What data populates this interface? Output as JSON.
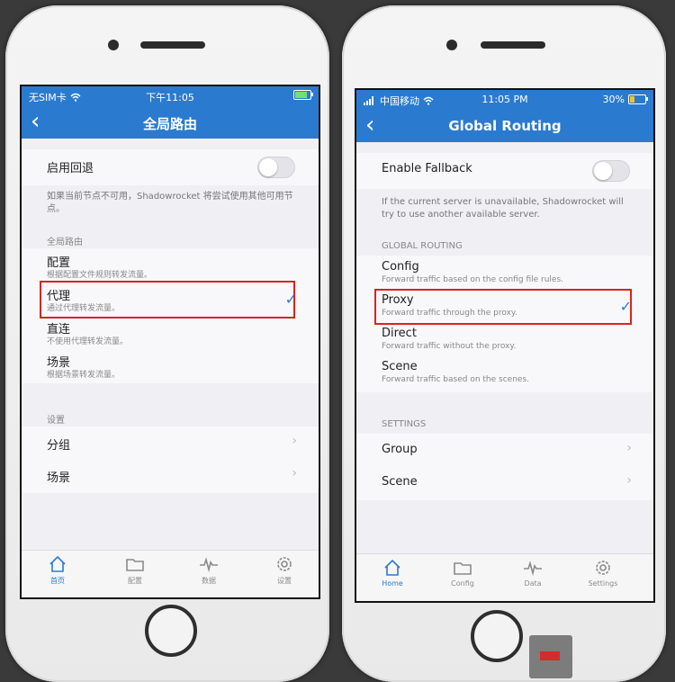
{
  "left": {
    "status": {
      "carrier": "无SIM卡",
      "time": "下午11:05"
    },
    "nav": {
      "back": "‹",
      "title": "全局路由"
    },
    "fallback": {
      "label": "启用回退",
      "enabled": false,
      "note": "如果当前节点不可用，Shadowrocket 将尝试使用其他可用节点。"
    },
    "routing_header": "全局路由",
    "routes": [
      {
        "title": "配置",
        "subtitle": "根据配置文件规则转发流量。",
        "selected": false
      },
      {
        "title": "代理",
        "subtitle": "通过代理转发流量。",
        "selected": true
      },
      {
        "title": "直连",
        "subtitle": "不使用代理转发流量。",
        "selected": false
      },
      {
        "title": "场景",
        "subtitle": "根据场景转发流量。",
        "selected": false
      }
    ],
    "settings_header": "设置",
    "settings": [
      {
        "label": "分组"
      },
      {
        "label": "场景"
      }
    ],
    "tabs": [
      {
        "label": "首页",
        "icon": "home-icon",
        "active": true
      },
      {
        "label": "配置",
        "icon": "folder-icon",
        "active": false
      },
      {
        "label": "数据",
        "icon": "pulse-icon",
        "active": false
      },
      {
        "label": "设置",
        "icon": "gear-icon",
        "active": false
      }
    ]
  },
  "right": {
    "status": {
      "carrier": "中国移动",
      "time": "11:05 PM",
      "battery": "30%",
      "battery_level": 0.3
    },
    "nav": {
      "back": "‹",
      "title": "Global Routing"
    },
    "fallback": {
      "label": "Enable Fallback",
      "enabled": false,
      "note": "If the current server is unavailable, Shadowrocket will try to use another available server."
    },
    "routing_header": "GLOBAL ROUTING",
    "routes": [
      {
        "title": "Config",
        "subtitle": "Forward traffic based on the config file rules.",
        "selected": false
      },
      {
        "title": "Proxy",
        "subtitle": "Forward traffic through the proxy.",
        "selected": true
      },
      {
        "title": "Direct",
        "subtitle": "Forward traffic without the proxy.",
        "selected": false
      },
      {
        "title": "Scene",
        "subtitle": "Forward traffic based on the scenes.",
        "selected": false
      }
    ],
    "settings_header": "SETTINGS",
    "settings": [
      {
        "label": "Group"
      },
      {
        "label": "Scene"
      }
    ],
    "tabs": [
      {
        "label": "Home",
        "icon": "home-icon",
        "active": true
      },
      {
        "label": "Config",
        "icon": "folder-icon",
        "active": false
      },
      {
        "label": "Data",
        "icon": "pulse-icon",
        "active": false
      },
      {
        "label": "Settings",
        "icon": "gear-icon",
        "active": false
      }
    ]
  },
  "colors": {
    "accent": "#2a7bcf",
    "highlight": "#d8241c",
    "check": "#2a7bcf"
  },
  "icons": {
    "check": "✓",
    "chevron": "›"
  }
}
